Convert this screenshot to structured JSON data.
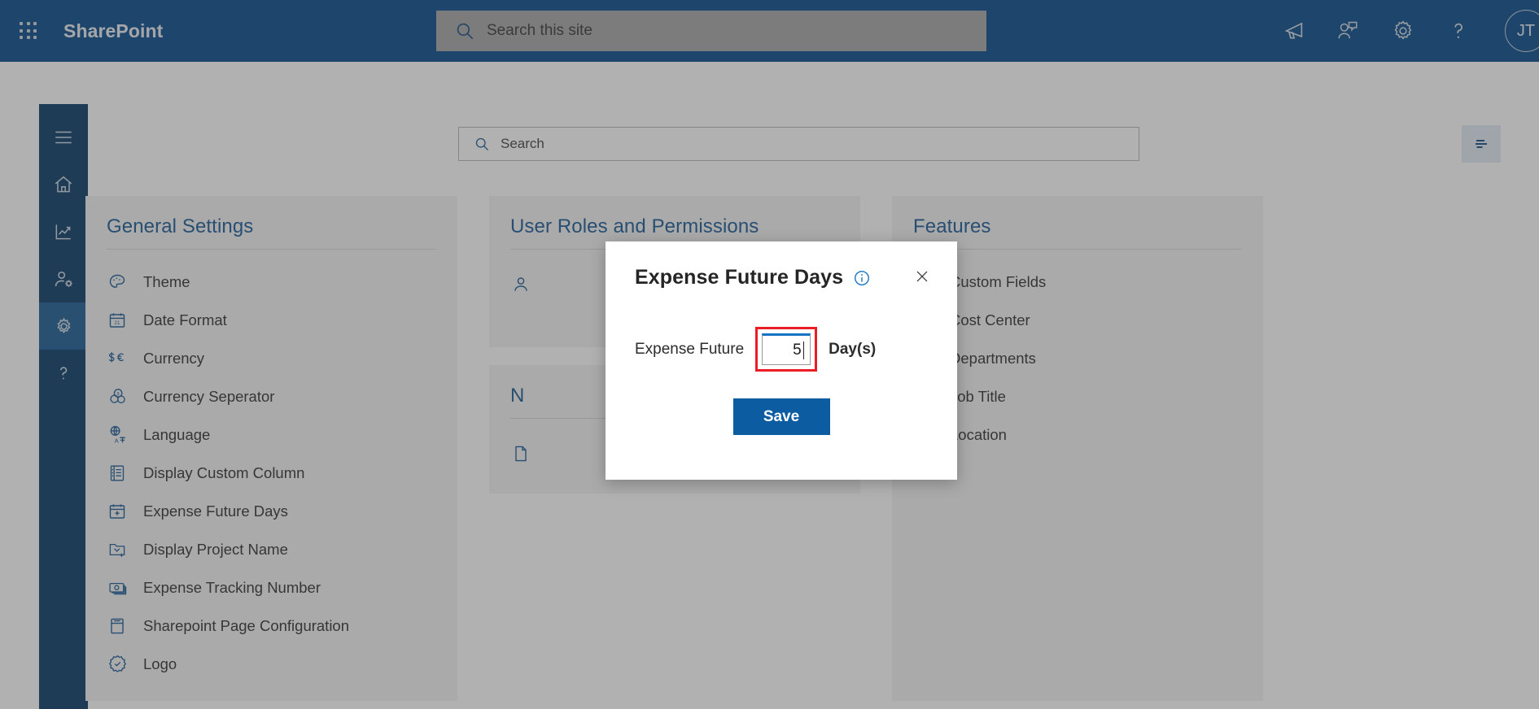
{
  "suite": {
    "waffle_label": "app-launcher",
    "brand": "SharePoint",
    "search_placeholder": "Search this site",
    "icons": [
      {
        "name": "megaphone-icon",
        "label": "Announcements"
      },
      {
        "name": "people-chat-icon",
        "label": "Feedback"
      },
      {
        "name": "gear-icon",
        "label": "Settings"
      },
      {
        "name": "help-icon",
        "label": "Help"
      }
    ],
    "avatar_initials": "JT"
  },
  "rail": {
    "items": [
      {
        "name": "hamburger-icon",
        "label": "Menu",
        "active": false
      },
      {
        "name": "home-icon",
        "label": "Home",
        "active": false
      },
      {
        "name": "analytics-icon",
        "label": "Reports",
        "active": false
      },
      {
        "name": "user-settings-icon",
        "label": "User Management",
        "active": false
      },
      {
        "name": "gear-icon",
        "label": "Settings",
        "active": true
      },
      {
        "name": "help-icon",
        "label": "Help",
        "active": false
      }
    ]
  },
  "toolbar": {
    "search_placeholder": "Search",
    "filter_label": "Filter"
  },
  "cards": [
    {
      "title": "General Settings",
      "items": [
        {
          "label": "Theme",
          "icon": "palette-icon"
        },
        {
          "label": "Date Format",
          "icon": "calendar-date-icon"
        },
        {
          "label": "Currency",
          "icon": "currency-icon"
        },
        {
          "label": "Currency Seperator",
          "icon": "coins-icon"
        },
        {
          "label": "Language",
          "icon": "translate-icon"
        },
        {
          "label": "Display Custom Column",
          "icon": "list-column-icon"
        },
        {
          "label": "Expense Future Days",
          "icon": "calendar-add-icon"
        },
        {
          "label": "Display Project Name",
          "icon": "folder-add-icon"
        },
        {
          "label": "Expense Tracking Number",
          "icon": "money-icon"
        },
        {
          "label": "Sharepoint Page Configuration",
          "icon": "page-icon"
        },
        {
          "label": "Logo",
          "icon": "badge-check-icon"
        }
      ]
    },
    {
      "title": "User Roles and Permissions",
      "items": [
        {
          "label": "",
          "icon": "person-icon"
        }
      ]
    },
    {
      "title": "Features",
      "items": [
        {
          "label": "Custom Fields",
          "icon": "layers-icon"
        },
        {
          "label": "Cost Center",
          "icon": "cost-center-icon"
        },
        {
          "label": "Departments",
          "icon": "briefcase-icon"
        },
        {
          "label": "Job Title",
          "icon": "document-edit-icon"
        },
        {
          "label": "Location",
          "icon": "bag-icon"
        }
      ]
    }
  ],
  "second_card_stub": {
    "title": "N",
    "item_icon": "document-icon"
  },
  "modal": {
    "title": "Expense Future Days",
    "info_icon": "info-icon",
    "close_icon": "close-icon",
    "field_label": "Expense Future",
    "field_value": "5",
    "field_unit": "Day(s)",
    "save_label": "Save"
  },
  "colors": {
    "suite_bar": "#0a4e8c",
    "rail": "#0b3c68",
    "rail_active": "#1d5c94",
    "card_bg": "#f3f3f3",
    "card_title": "#1c5a96",
    "icon_blue": "#1b5c96",
    "primary_button": "#0b5ca0",
    "highlight_red": "#ec1c24",
    "focus_blue": "#1573c4"
  }
}
